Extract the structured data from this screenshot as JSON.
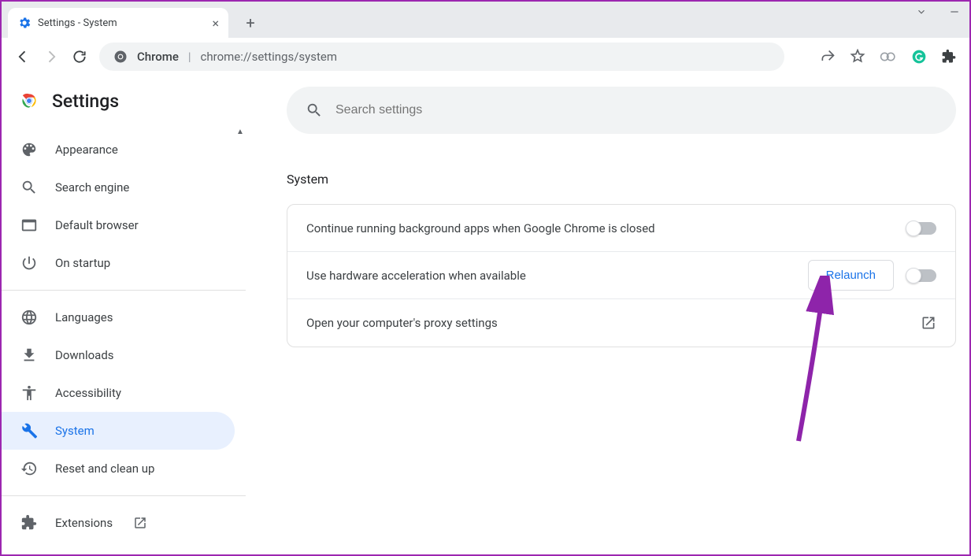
{
  "tab": {
    "title": "Settings - System"
  },
  "address": {
    "label": "Chrome",
    "url": "chrome://settings/system"
  },
  "header": {
    "title": "Settings"
  },
  "search": {
    "placeholder": "Search settings"
  },
  "sidebar": {
    "items": [
      {
        "label": "Appearance"
      },
      {
        "label": "Search engine"
      },
      {
        "label": "Default browser"
      },
      {
        "label": "On startup"
      },
      {
        "label": "Languages"
      },
      {
        "label": "Downloads"
      },
      {
        "label": "Accessibility"
      },
      {
        "label": "System"
      },
      {
        "label": "Reset and clean up"
      },
      {
        "label": "Extensions"
      }
    ]
  },
  "main": {
    "section_title": "System",
    "rows": [
      {
        "text": "Continue running background apps when Google Chrome is closed"
      },
      {
        "text": "Use hardware acceleration when available",
        "button": "Relaunch"
      },
      {
        "text": "Open your computer's proxy settings"
      }
    ]
  }
}
